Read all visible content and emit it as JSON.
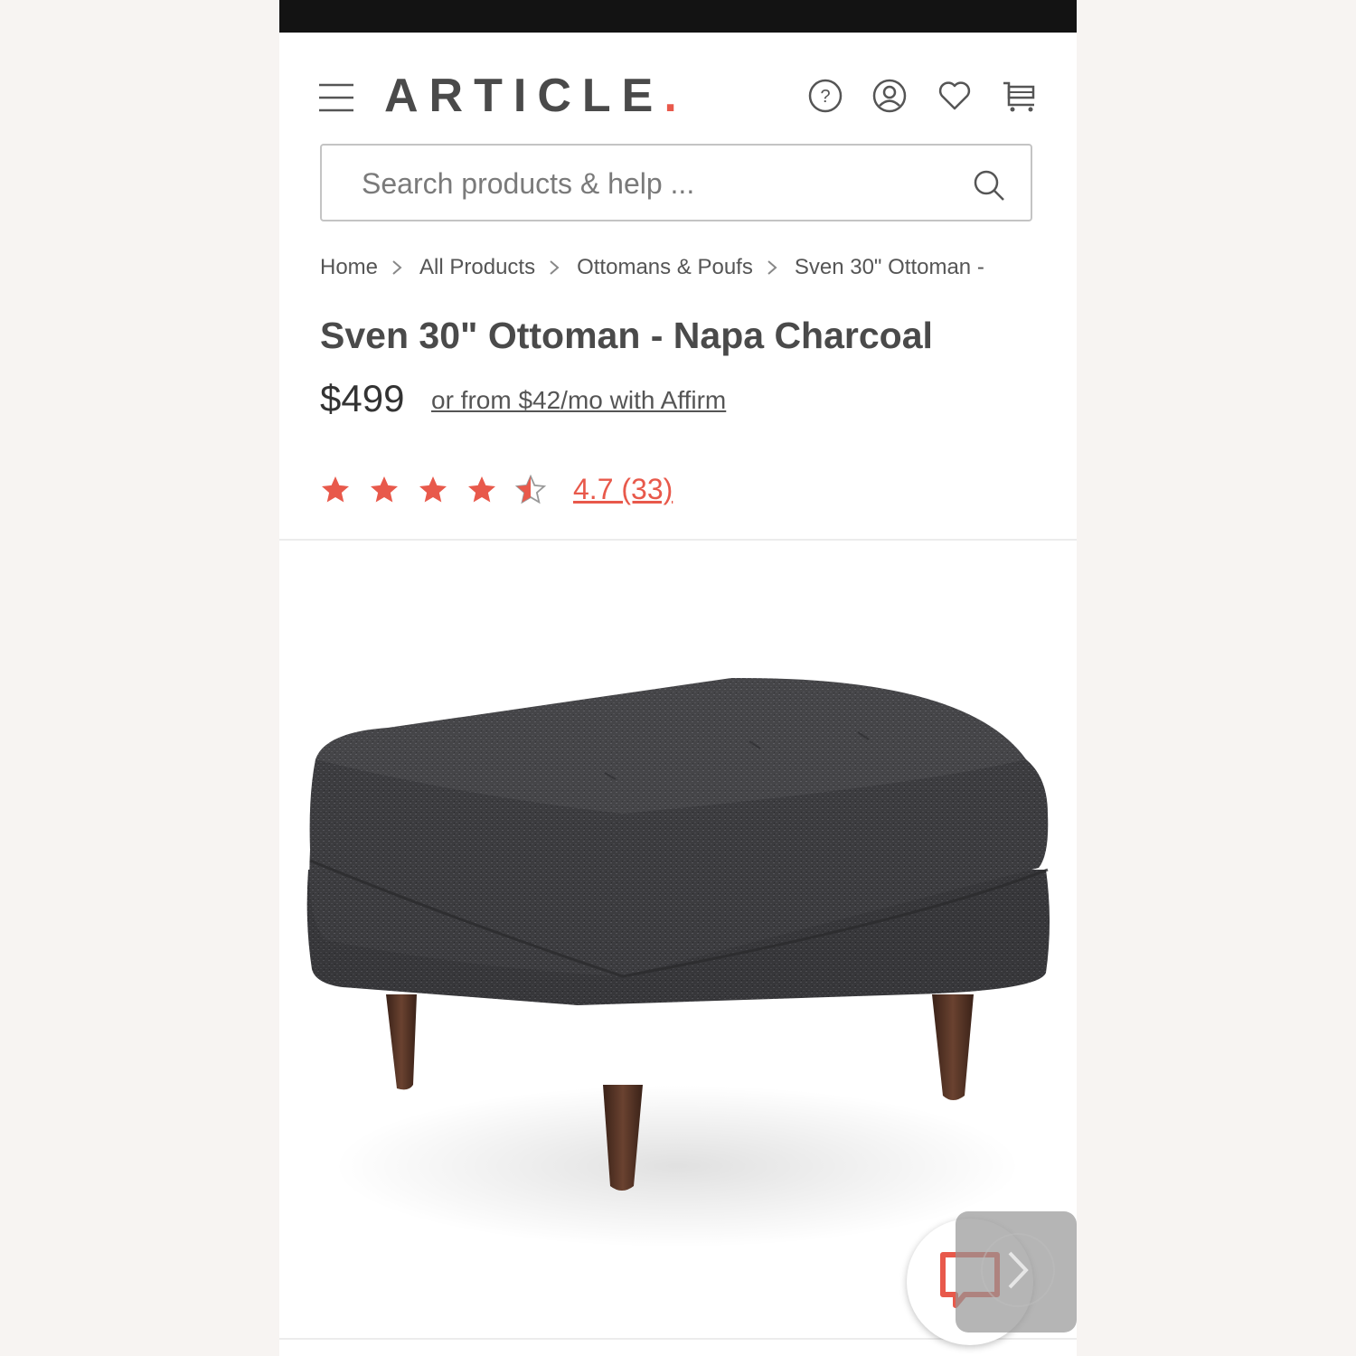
{
  "brand": {
    "logo_text": "ARTICLE",
    "logo_dot": ".",
    "accent_color": "#e8594b"
  },
  "header": {
    "icons": [
      "menu-icon",
      "help-icon",
      "account-icon",
      "wishlist-icon",
      "cart-icon"
    ]
  },
  "search": {
    "placeholder": "Search products & help ..."
  },
  "breadcrumb": {
    "items": [
      "Home",
      "All Products",
      "Ottomans & Poufs",
      "Sven 30\" Ottoman -"
    ]
  },
  "product": {
    "title": "Sven 30\" Ottoman - Napa Charcoal",
    "price": "$499",
    "financing": "or from $42/mo with Affirm",
    "rating_text": "4.7 (33)",
    "rating_value": 4.7,
    "rating_max": 5,
    "image_label": "charcoal-ottoman-image"
  },
  "widgets": {
    "chat_icon": "chat-icon",
    "next_icon": "chevron-right-icon"
  }
}
